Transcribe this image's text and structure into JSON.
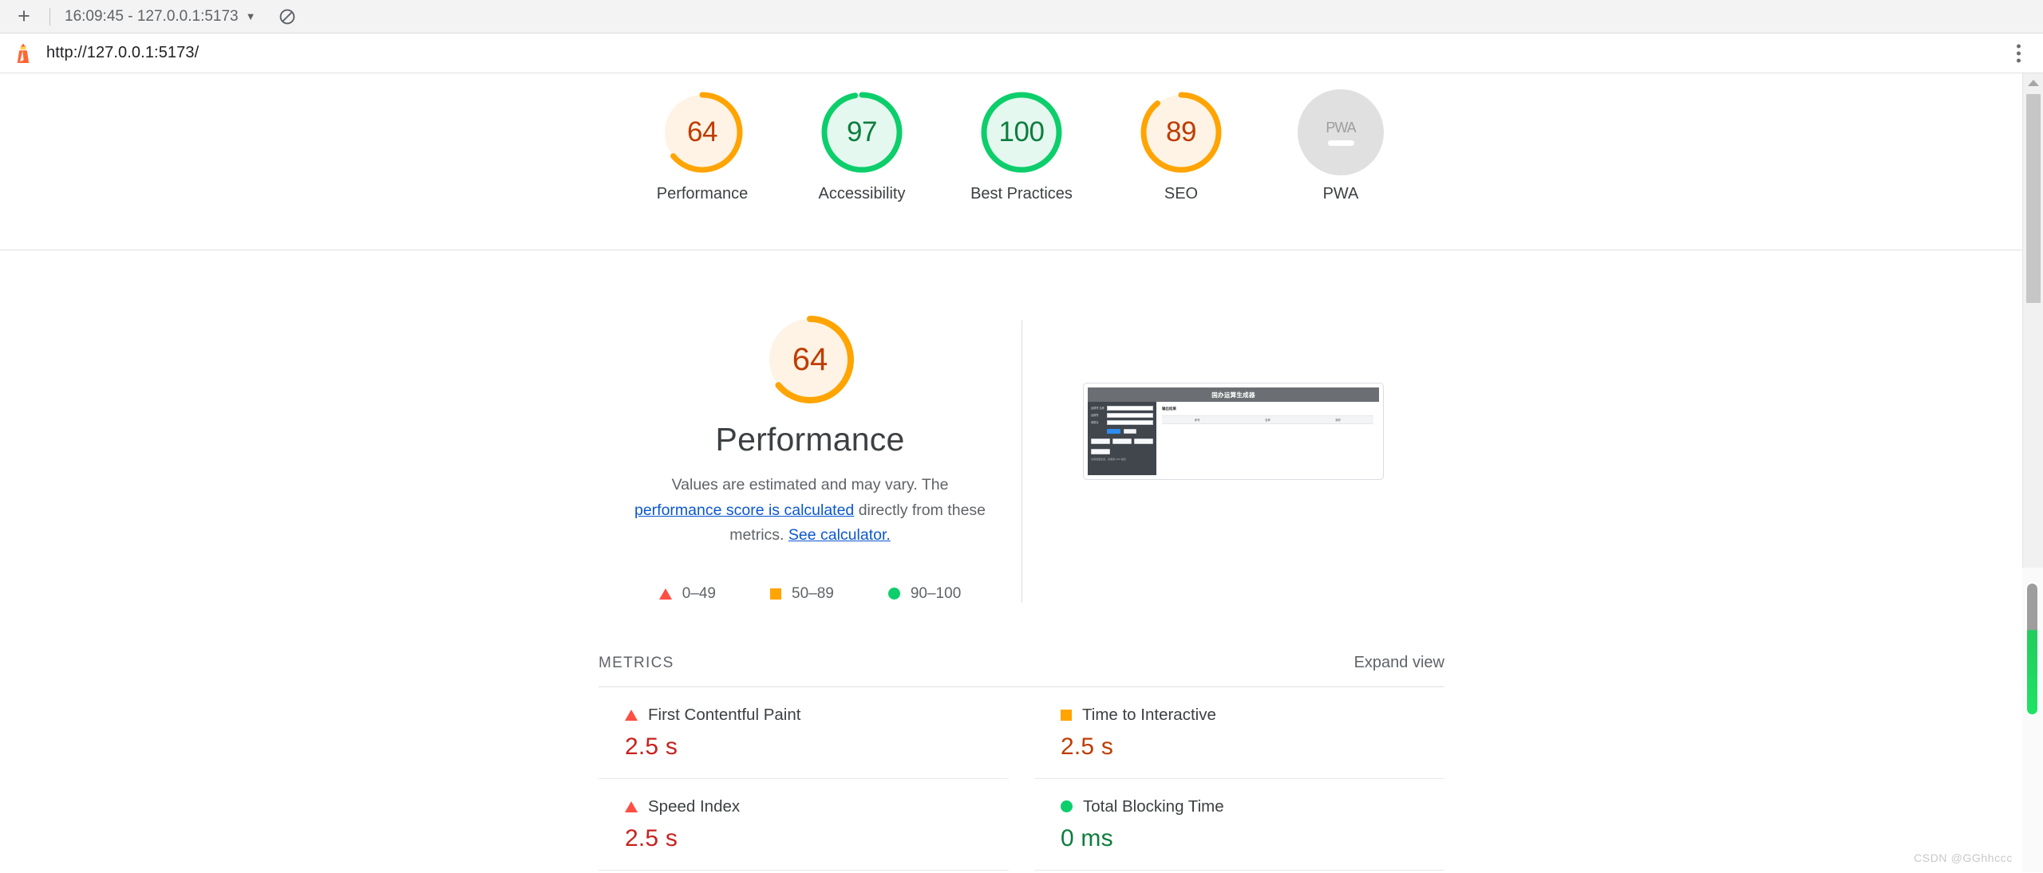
{
  "toolbar": {
    "new_label": "+",
    "run_select": "16:09:45 - 127.0.0.1:5173",
    "caret": "▼",
    "clear_title": "Clear all"
  },
  "urlbar": {
    "url": "http://127.0.0.1:5173/"
  },
  "scores": [
    {
      "label": "Performance",
      "value": "64",
      "percent": 64,
      "state": "average",
      "color": "#ffa400",
      "track": "#fef3e4",
      "text_color": "#bf3c00"
    },
    {
      "label": "Accessibility",
      "value": "97",
      "percent": 97,
      "state": "pass",
      "color": "#0cce6b",
      "track": "#e4f8ef",
      "text_color": "#0d7d3e"
    },
    {
      "label": "Best Practices",
      "value": "100",
      "percent": 100,
      "state": "pass",
      "color": "#0cce6b",
      "track": "#e4f8ef",
      "text_color": "#0d7d3e"
    },
    {
      "label": "SEO",
      "value": "89",
      "percent": 89,
      "state": "average",
      "color": "#ffa400",
      "track": "#fef3e4",
      "text_color": "#bf3c00"
    },
    {
      "label": "PWA",
      "value": "",
      "percent": 0,
      "state": "null",
      "color": "#e0e0e0",
      "track": "#e0e0e0",
      "text_color": "#9e9e9e",
      "badge_text": "PWA"
    }
  ],
  "category": {
    "gauge_value": "64",
    "gauge_percent": 64,
    "title": "Performance",
    "desc_part1": "Values are estimated and may vary. The ",
    "desc_link1": "performance score is calculated",
    "desc_part2": " directly from these metrics. ",
    "desc_link2": "See calculator.",
    "legend": [
      {
        "icon": "triangle-swatch",
        "range": "0–49",
        "color": "#ff4e42"
      },
      {
        "icon": "square-swatch",
        "range": "50–89",
        "color": "#ffa400"
      },
      {
        "icon": "circle-swatch",
        "range": "90–100",
        "color": "#0cce6b"
      }
    ]
  },
  "thumbnail": {
    "page_title": "国办运算生成器",
    "form_labels": [
      "运算符\n名称",
      "运算符",
      "参数名"
    ],
    "primary_button": "生成",
    "secondary_button": "重置",
    "action_buttons": [
      "下载文件",
      "下载源码",
      "清空输出"
    ],
    "extra_button": "上传文件",
    "note": "支持批量生成，请使用 CSV 格式",
    "main_title": "输出结果",
    "table_headers": [
      "序号",
      "名称",
      "操作"
    ]
  },
  "metrics": {
    "section_title": "METRICS",
    "expand_label": "Expand view",
    "items": [
      {
        "name": "First Contentful Paint",
        "value": "2.5 s",
        "icon": "triangle-swatch",
        "state": "fail",
        "swatch_color": "#ff4e42",
        "value_class": "v-red"
      },
      {
        "name": "Time to Interactive",
        "value": "2.5 s",
        "icon": "square-swatch",
        "state": "average",
        "swatch_color": "#ffa400",
        "value_class": "v-orange"
      },
      {
        "name": "Speed Index",
        "value": "2.5 s",
        "icon": "triangle-swatch",
        "state": "fail",
        "swatch_color": "#ff4e42",
        "value_class": "v-red"
      },
      {
        "name": "Total Blocking Time",
        "value": "0 ms",
        "icon": "circle-swatch",
        "state": "pass",
        "swatch_color": "#0cce6b",
        "value_class": "v-green"
      }
    ]
  },
  "watermark": "CSDN @GGhhccc"
}
